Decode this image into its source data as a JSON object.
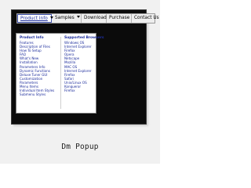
{
  "menubar": {
    "items": [
      {
        "label": "Product Info",
        "has_dropdown": true,
        "active": true
      },
      {
        "label": "Samples",
        "has_dropdown": true,
        "active": false
      },
      {
        "label": "Download",
        "has_dropdown": false,
        "active": false
      },
      {
        "label": "Purchase",
        "has_dropdown": false,
        "active": false
      },
      {
        "label": "Contact Us",
        "has_dropdown": false,
        "active": false
      }
    ]
  },
  "dropdown": {
    "left": {
      "heading": "Product Info",
      "items": [
        "Features",
        "Description of Files",
        "How To Setup",
        "FAQ",
        "What's New",
        "Installation",
        "Parameters Info",
        "Dynamic Functions",
        "Deluxe Tuner GUI",
        "Customization",
        "Parameters",
        "Menu Items",
        "Individual Item Styles",
        "Submenu Styles"
      ]
    },
    "right": {
      "heading": "Supported Browsers",
      "items": [
        "Windows OS",
        "Internet Explorer",
        "Firefox",
        "Opera",
        "Netscape",
        "Mozilla",
        "MAC OS",
        "Internet Explorer",
        "Firefox",
        "Safari",
        "Unix/Linux OS",
        "Konqueror",
        "Firefox"
      ]
    }
  },
  "caption": "Dm Popup",
  "colors": {
    "background": "#f1f1f1",
    "screen": "#0b0b0b",
    "link": "#1d2d9c",
    "menubar": "#eeeeee"
  }
}
